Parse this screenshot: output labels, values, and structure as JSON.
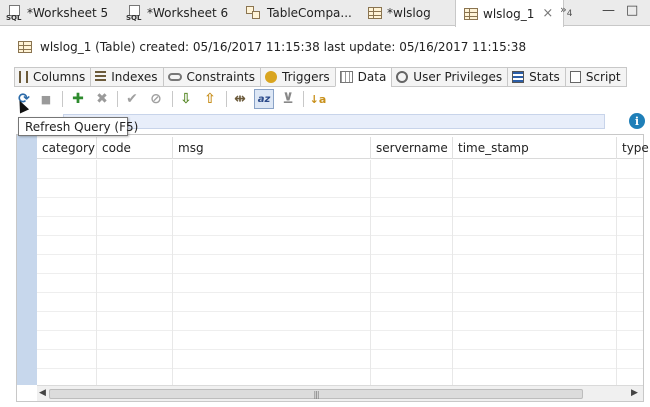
{
  "editor_tabs": [
    {
      "label": "*Worksheet 5",
      "icon": "sql-worksheet-icon"
    },
    {
      "label": "*Worksheet 6",
      "icon": "sql-worksheet-icon"
    },
    {
      "label": "TableCompa...",
      "icon": "table-compare-icon"
    },
    {
      "label": "*wlslog",
      "icon": "table-icon"
    },
    {
      "label": "wlslog_1",
      "icon": "table-icon",
      "active": true,
      "close": "×"
    }
  ],
  "overflow": {
    "symbol": "»",
    "count": "4"
  },
  "window_controls": {
    "minimize": "—",
    "maximize": "□"
  },
  "sql_icon_text": "SQL",
  "header_info": "wlslog_1 (Table) created: 05/16/2017 11:15:38 last update: 05/16/2017 11:15:38",
  "sub_tabs": [
    {
      "label": "Columns",
      "icon": "columns-icon"
    },
    {
      "label": "Indexes",
      "icon": "indexes-icon"
    },
    {
      "label": "Constraints",
      "icon": "constraints-icon"
    },
    {
      "label": "Triggers",
      "icon": "triggers-icon"
    },
    {
      "label": "Data",
      "icon": "data-grid-icon",
      "active": true
    },
    {
      "label": "User Privileges",
      "icon": "user-privileges-icon"
    },
    {
      "label": "Stats",
      "icon": "stats-icon"
    },
    {
      "label": "Script",
      "icon": "script-icon"
    }
  ],
  "toolbar_glyphs": {
    "refresh": "⟳",
    "stop": "■",
    "add": "✚",
    "delete": "✖",
    "commit": "✔",
    "rollback": "⊘",
    "export": "⇩",
    "import": "⇧",
    "columns": "⇹",
    "sort": "az",
    "filter": "⊻",
    "order": "↓a"
  },
  "tooltip": "Refresh Query (F5)",
  "info_glyph": "i",
  "columns": [
    "category",
    "code",
    "msg",
    "servername",
    "time_stamp",
    "type"
  ],
  "scrollbar": {
    "left": "◀",
    "right": "▶",
    "grip": "|||"
  },
  "colors": {
    "row_header": "#c7d7ec",
    "filter_bar": "#e8eefa",
    "info": "#1f7fb8",
    "add": "#2e8b2e",
    "delete": "#9a9a9a"
  }
}
